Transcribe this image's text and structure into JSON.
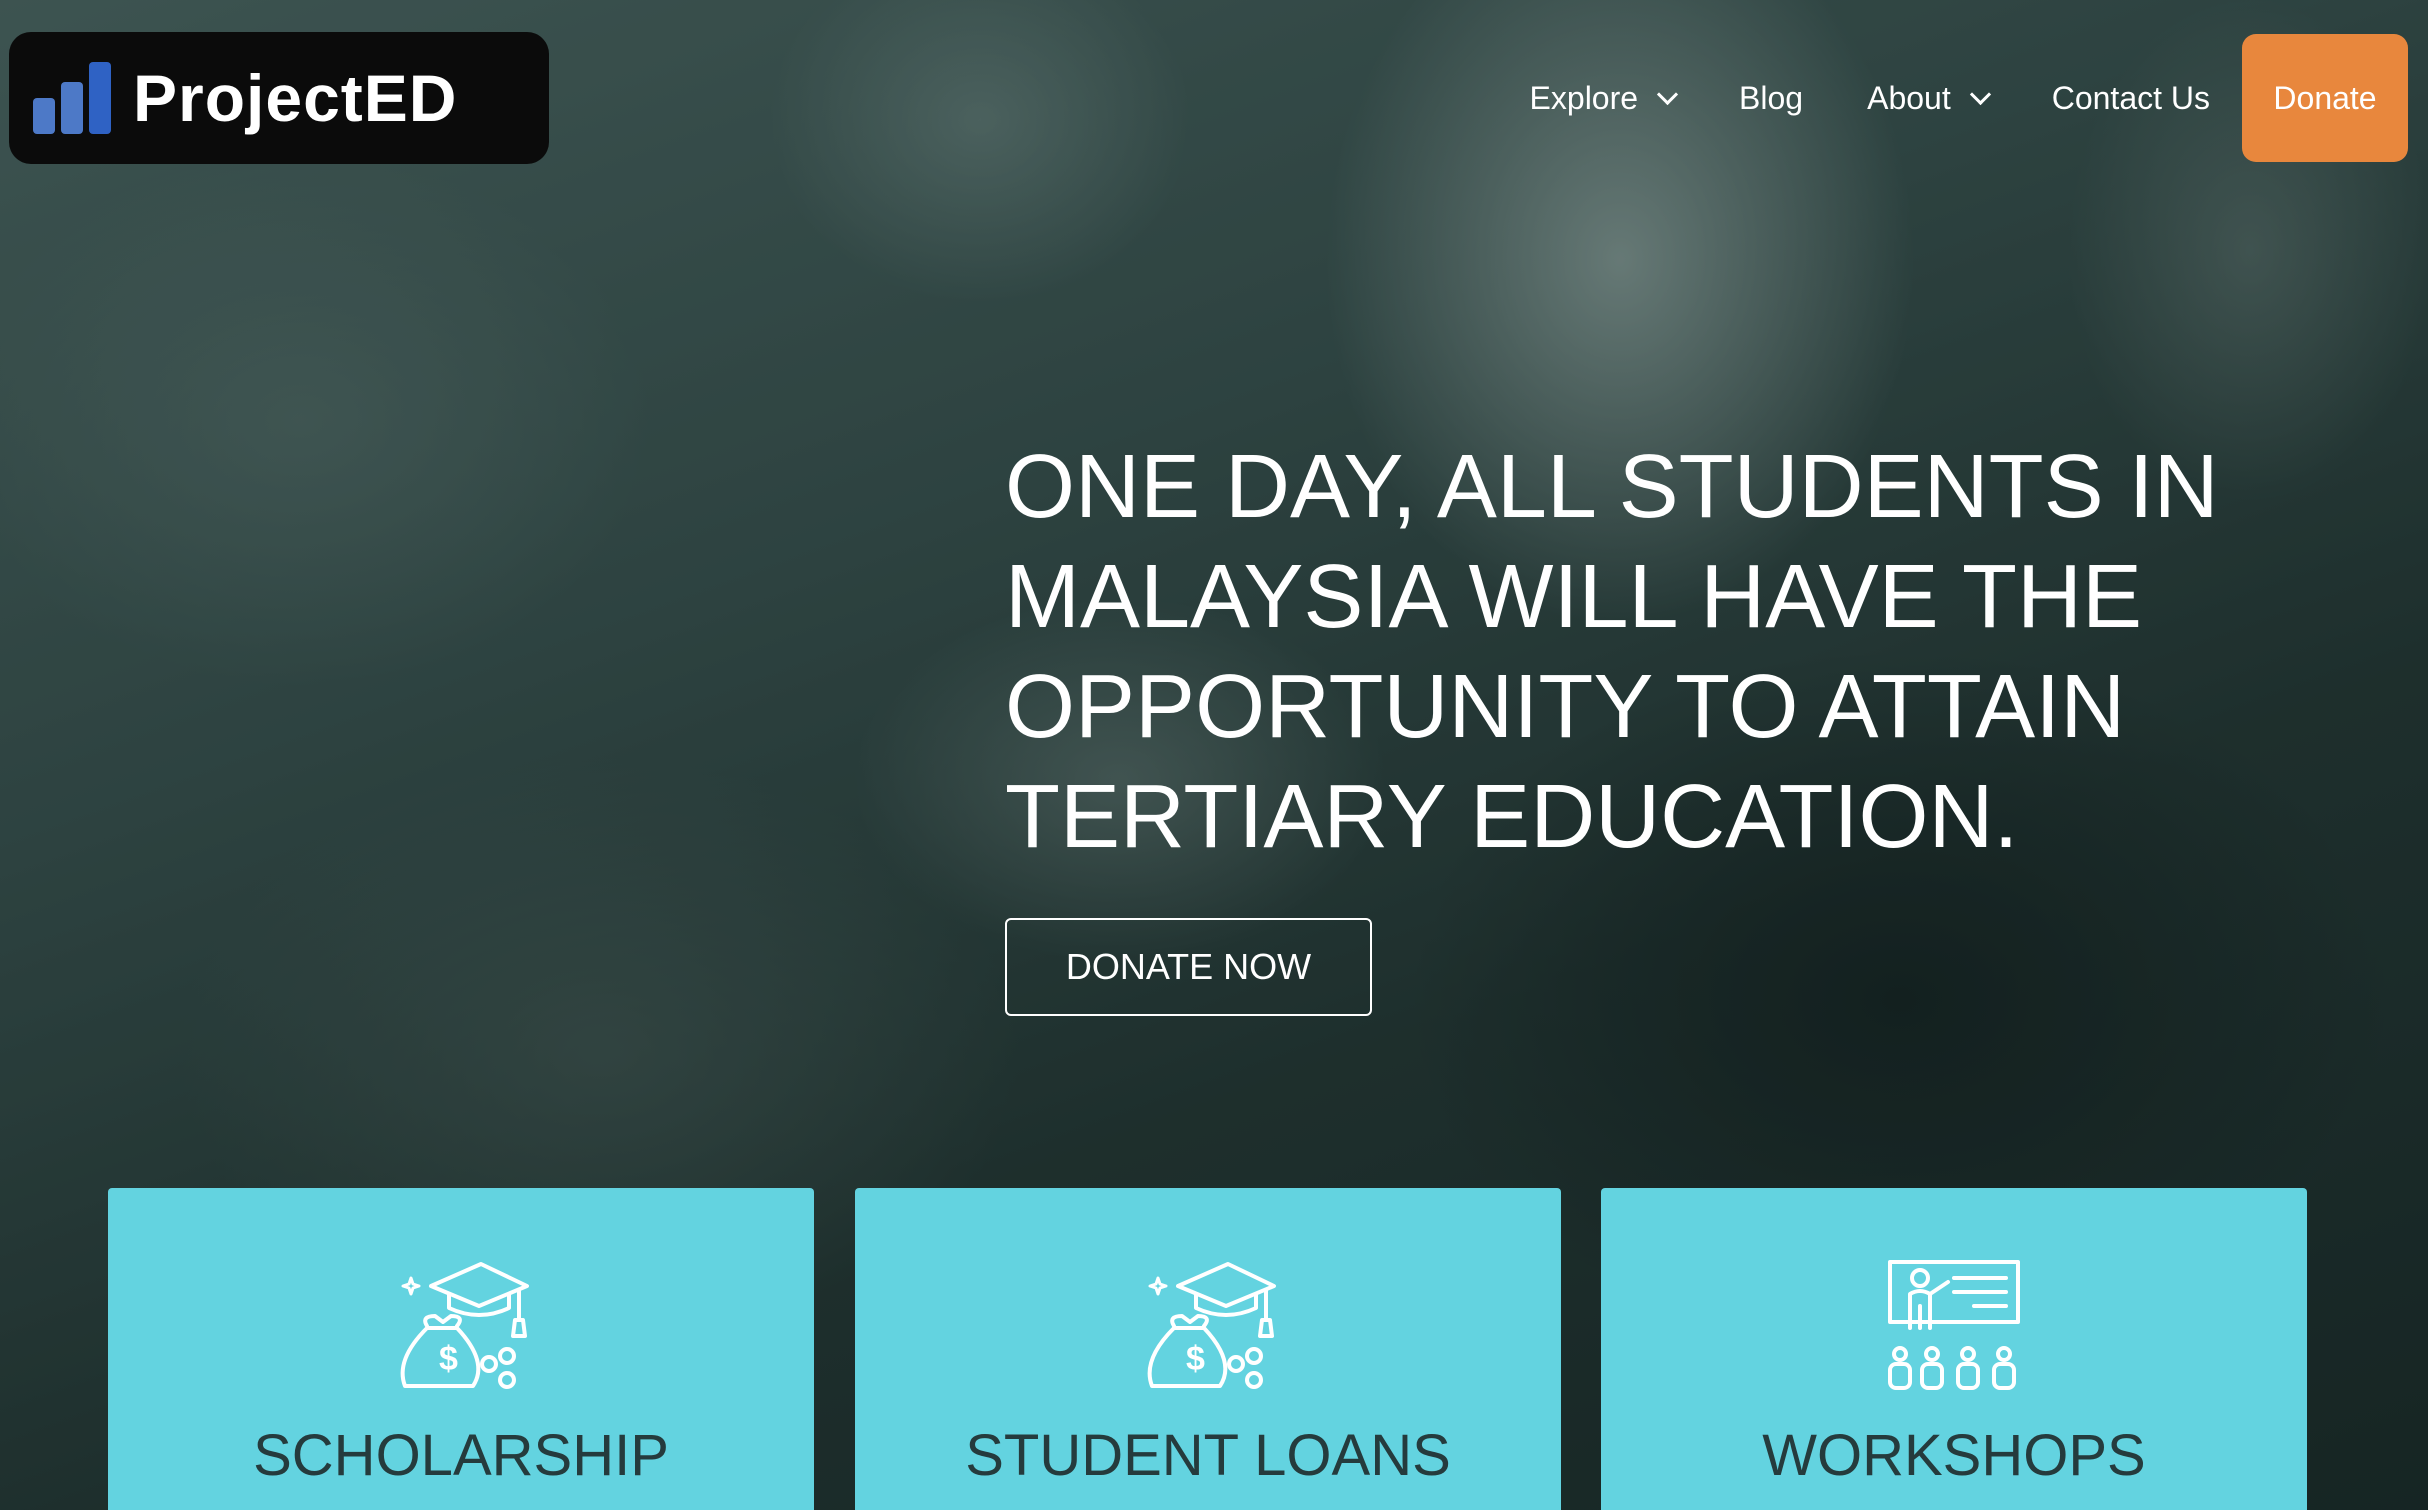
{
  "brand": {
    "name": "ProjectED"
  },
  "nav": {
    "items": [
      {
        "label": "Explore",
        "has_dropdown": true
      },
      {
        "label": "Blog",
        "has_dropdown": false
      },
      {
        "label": "About",
        "has_dropdown": true
      },
      {
        "label": "Contact Us",
        "has_dropdown": false
      }
    ],
    "donate_label": "Donate"
  },
  "hero": {
    "headline_lines": [
      "ONE DAY, ALL STUDENTS IN",
      "MALAYSIA WILL HAVE THE",
      "OPPORTUNITY TO ATTAIN",
      "TERTIARY EDUCATION."
    ],
    "cta_label": "DONATE NOW"
  },
  "cards": [
    {
      "title": "SCHOLARSHIP",
      "icon": "graduation-cap-money-bag-icon"
    },
    {
      "title": "STUDENT LOANS",
      "icon": "graduation-cap-money-bag-icon"
    },
    {
      "title": "WORKSHOPS",
      "icon": "presenter-audience-icon"
    }
  ],
  "colors": {
    "accent": "#e8873d",
    "card": "#63d3e0",
    "card_text": "#253b3d",
    "logo_bg": "#0b0b0b"
  }
}
